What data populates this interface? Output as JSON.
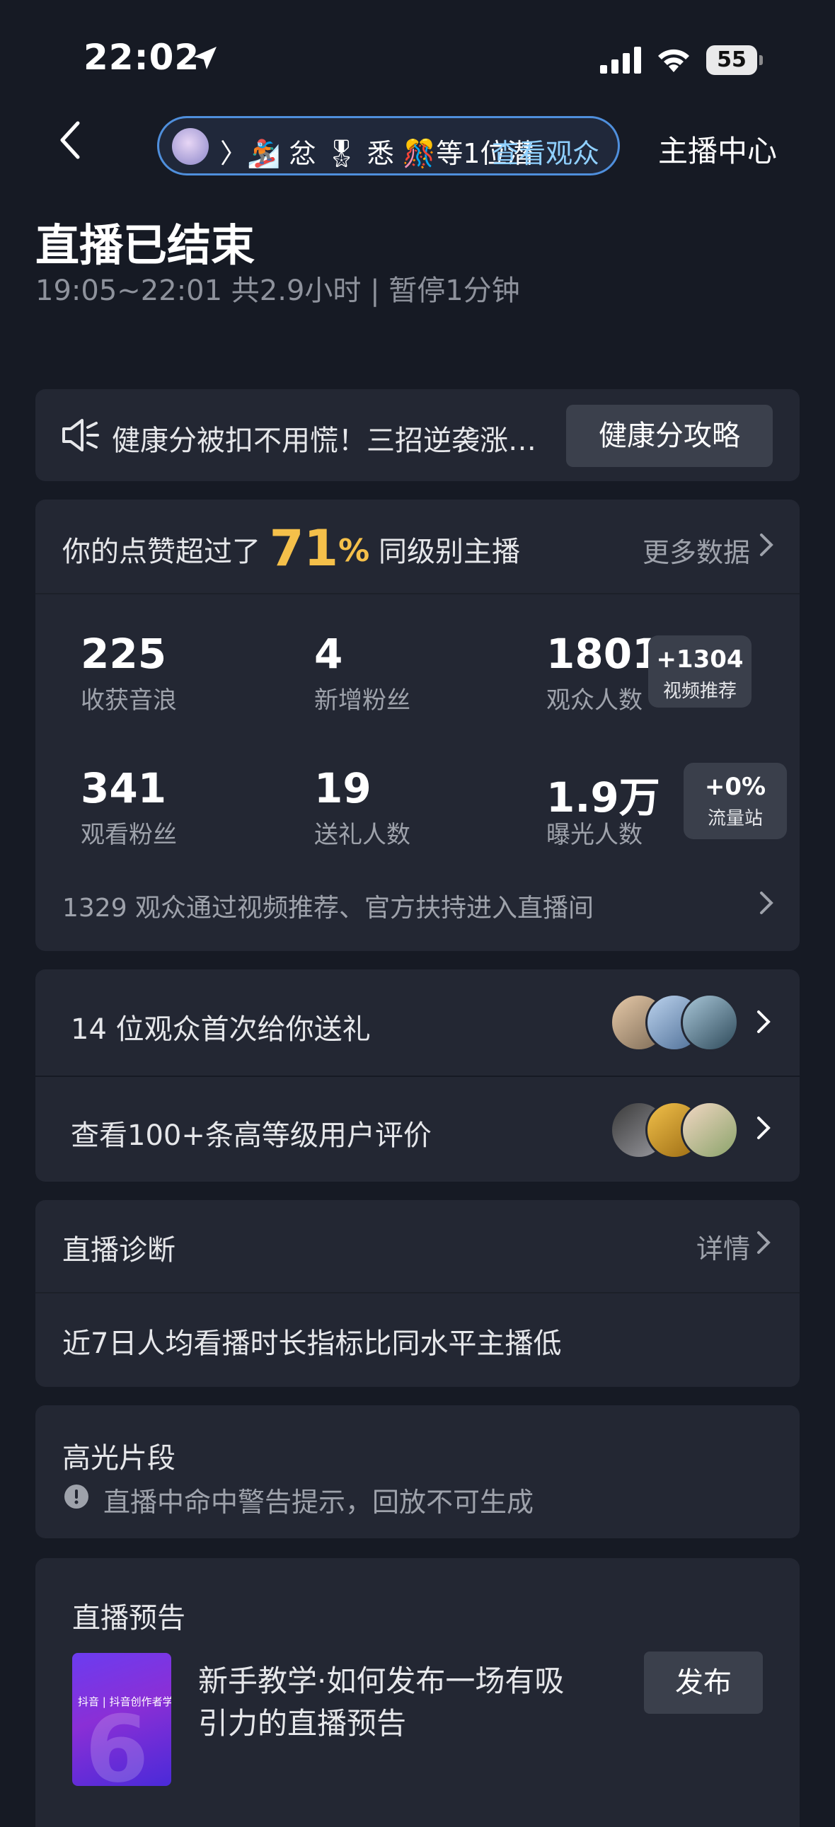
{
  "status_bar": {
    "time": "22:02",
    "battery": "55"
  },
  "nav": {
    "viewer_pill_text": "〉🏂 忿 🎖 悉 🎊等1位潜",
    "viewer_link": "查看观众",
    "anchor_center": "主播中心"
  },
  "header": {
    "title": "直播已结束",
    "subtitle": "19:05~22:01 共2.9小时 | 暂停1分钟"
  },
  "health": {
    "text": "健康分被扣不用慌！三招逆袭涨…",
    "button": "健康分攻略"
  },
  "stats": {
    "head_prefix": "你的点赞超过了",
    "percent": "71",
    "percent_sign": "%",
    "head_suffix": "同级别主播",
    "more": "更多数据",
    "metrics": [
      {
        "value": "225",
        "label": "收获音浪"
      },
      {
        "value": "4",
        "label": "新增粉丝"
      },
      {
        "value": "1801",
        "label": "观众人数"
      },
      {
        "value": "341",
        "label": "观看粉丝"
      },
      {
        "value": "19",
        "label": "送礼人数"
      },
      {
        "value": "1.9万",
        "label": "曝光人数"
      }
    ],
    "badge_video": {
      "value": "+1304",
      "label": "视频推荐"
    },
    "badge_flow": {
      "value": "+0%",
      "label": "流量站"
    },
    "footer": "1329 观众通过视频推荐、官方扶持进入直播间"
  },
  "gift_row": {
    "text": "14 位观众首次给你送礼"
  },
  "review_row": {
    "text": "查看100+条高等级用户评价"
  },
  "diagnosis": {
    "title": "直播诊断",
    "more": "详情",
    "body": "近7日人均看播时长指标比同水平主播低"
  },
  "highlight": {
    "title": "高光片段",
    "body": "直播中命中警告提示，回放不可生成"
  },
  "preview": {
    "title": "直播预告",
    "thumb_label": "抖音 | 抖音创作者学院",
    "desc_line1": "新手教学·如何发布一场有吸",
    "desc_line2": "引力的直播预告",
    "button": "发布"
  },
  "colors": {
    "accent_gold": "#f5c04a",
    "link_blue": "#8fd0ff",
    "pill_border": "#4f8fdc"
  }
}
